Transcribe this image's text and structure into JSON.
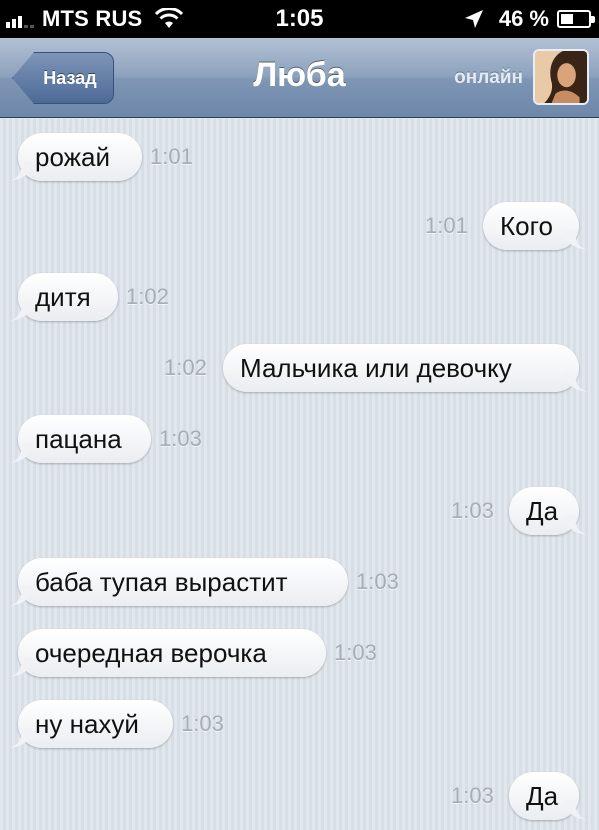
{
  "status_bar": {
    "carrier": "MTS RUS",
    "time": "1:05",
    "battery_percent": "46 %",
    "battery_level": 0.46,
    "signal_bars_on": 3,
    "signal_bars_total": 5
  },
  "nav": {
    "back_label": "Назад",
    "title": "Люба",
    "presence": "онлайн"
  },
  "messages": [
    {
      "side": "left",
      "text": "рожай",
      "time": "1:01"
    },
    {
      "side": "right",
      "text": "Кого",
      "time": "1:01"
    },
    {
      "side": "left",
      "text": "дитя",
      "time": "1:02"
    },
    {
      "side": "right",
      "text": "Мальчика или девочку",
      "time": "1:02"
    },
    {
      "side": "left",
      "text": "пацана",
      "time": "1:03"
    },
    {
      "side": "right",
      "text": "Да",
      "time": "1:03"
    },
    {
      "side": "left",
      "text": "баба тупая вырастит",
      "time": "1:03"
    },
    {
      "side": "left",
      "text": "очередная верочка",
      "time": "1:03"
    },
    {
      "side": "left",
      "text": "ну нахуй",
      "time": "1:03"
    },
    {
      "side": "right",
      "text": "Да",
      "time": "1:03"
    }
  ],
  "colors": {
    "nav_bar": "#7f96b4",
    "background": "#dce2ea",
    "bubble": "#ffffff",
    "timestamp": "#a6adb8"
  },
  "icons": {
    "signal": "signal-icon",
    "wifi": "wifi-icon",
    "location": "location-arrow-icon",
    "battery": "battery-icon"
  }
}
